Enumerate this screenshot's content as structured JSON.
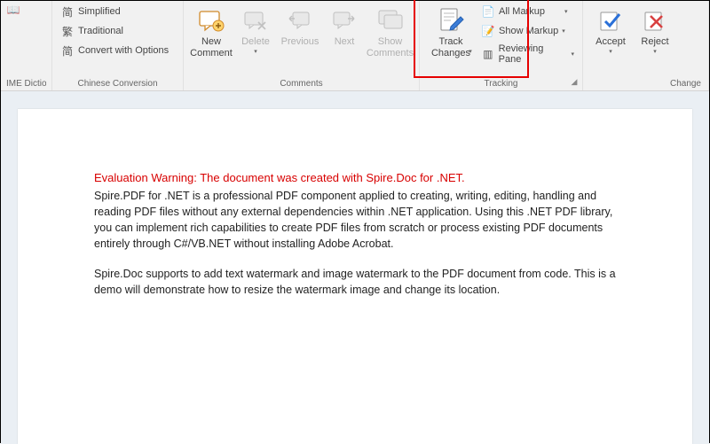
{
  "ribbon": {
    "ime_label": "IME Dictionary",
    "chinese": {
      "simplified": "Simplified",
      "traditional": "Traditional",
      "convert_opts": "Convert with Options",
      "group": "Chinese Conversion"
    },
    "comments": {
      "new": "New\nComment",
      "delete": "Delete",
      "previous": "Previous",
      "next": "Next",
      "show": "Show\nComments",
      "group": "Comments"
    },
    "tracking": {
      "track": "Track\nChanges",
      "all_markup": "All Markup",
      "show_markup": "Show Markup",
      "reviewing_pane": "Reviewing Pane",
      "group": "Tracking"
    },
    "changes": {
      "accept": "Accept",
      "reject": "Reject",
      "group": "Change"
    }
  },
  "document": {
    "warning": "Evaluation Warning: The document was created with Spire.Doc for .NET.",
    "p1": "Spire.PDF for .NET is a professional PDF component applied to creating, writing, editing, handling and reading PDF files without any external dependencies within .NET application. Using this .NET PDF library, you can implement rich capabilities to create PDF files from scratch or process existing PDF documents entirely through C#/VB.NET without installing Adobe Acrobat.",
    "p2": "Spire.Doc supports to add text watermark and image watermark to the PDF document from code. This is a demo will demonstrate how to resize the watermark image and change its location."
  }
}
